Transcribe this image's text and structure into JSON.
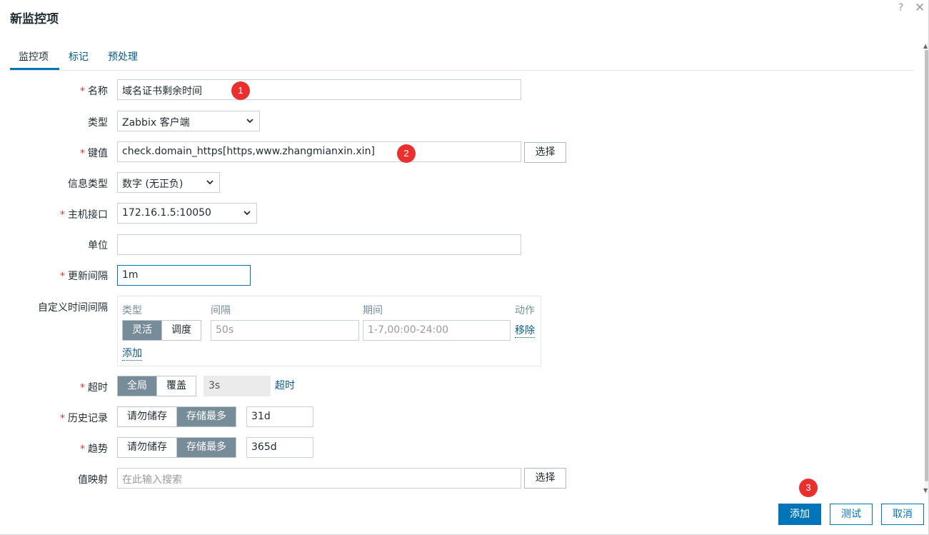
{
  "dialog": {
    "title": "新监控项",
    "help": "?",
    "close": "✕"
  },
  "tabs": [
    "监控项",
    "标记",
    "预处理"
  ],
  "fields": {
    "name": {
      "label": "名称",
      "value": "域名证书剩余时间"
    },
    "type": {
      "label": "类型",
      "value": "Zabbix 客户端"
    },
    "key": {
      "label": "键值",
      "value": "check.domain_https[https,www.zhangmianxin.xin]",
      "button": "选择"
    },
    "info_type": {
      "label": "信息类型",
      "value": "数字 (无正负)"
    },
    "host_interface": {
      "label": "主机接口",
      "value": "172.16.1.5:10050"
    },
    "units": {
      "label": "单位",
      "value": ""
    },
    "update_interval": {
      "label": "更新间隔",
      "value": "1m"
    },
    "custom_intervals": {
      "label": "自定义时间间隔",
      "headers": [
        "类型",
        "间隔",
        "期间",
        "动作"
      ],
      "mode_options": [
        "灵活",
        "调度"
      ],
      "interval_placeholder": "50s",
      "period_placeholder": "1-7,00:00-24:00",
      "remove": "移除",
      "add": "添加"
    },
    "timeout": {
      "label": "超时",
      "options": [
        "全局",
        "覆盖"
      ],
      "value": "3s",
      "link": "超时"
    },
    "history": {
      "label": "历史记录",
      "options": [
        "请勿储存",
        "存储最多"
      ],
      "value": "31d"
    },
    "trends": {
      "label": "趋势",
      "options": [
        "请勿储存",
        "存储最多"
      ],
      "value": "365d"
    },
    "value_map": {
      "label": "值映射",
      "placeholder": "在此输入搜索",
      "button": "选择"
    }
  },
  "annotations": [
    "1",
    "2",
    "3"
  ],
  "footer": {
    "add": "添加",
    "test": "测试",
    "cancel": "取消"
  },
  "colors": {
    "accent": "#0275b8",
    "segment_active": "#768d99",
    "required": "#e33734",
    "badge": "#e9302f"
  }
}
